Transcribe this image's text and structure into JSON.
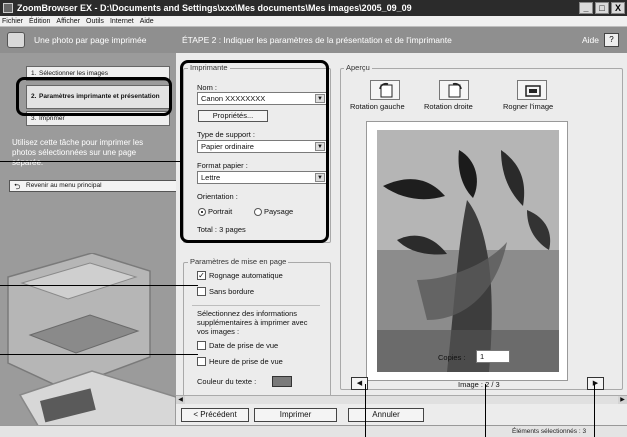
{
  "window": {
    "title": "ZoomBrowser EX - D:\\Documents and Settings\\xxx\\Mes documents\\Mes images\\2005_09_09",
    "controls": [
      "_",
      "□",
      "X"
    ]
  },
  "menu": [
    "Fichier",
    "Édition",
    "Afficher",
    "Outils",
    "Internet",
    "Aide"
  ],
  "taskbar": {
    "task_title": "Une photo par page imprimée",
    "step_title": "ÉTAPE 2 : Indiquer les paramètres de la présentation et de l'imprimante",
    "help_label": "Aide",
    "help_button": "?"
  },
  "sidebar": {
    "steps": [
      {
        "num": "1.",
        "label": "Sélectionner les images"
      },
      {
        "num": "2.",
        "label": "Paramètres imprimante et présentation"
      },
      {
        "num": "3.",
        "label": "Imprimer"
      }
    ],
    "hint": "Utilisez cette tâche pour imprimer les photos sélectionnées sur une page séparée.",
    "back_button": "Revenir au menu principal"
  },
  "printer_group": {
    "title": "Imprimante",
    "name_label": "Nom :",
    "name_value": "Canon XXXXXXXX",
    "properties_button": "Propriétés...",
    "media_label": "Type de support :",
    "media_value": "Papier ordinaire",
    "paper_label": "Format papier :",
    "paper_value": "Lettre",
    "orientation_label": "Orientation :",
    "portrait": "Portrait",
    "landscape": "Paysage",
    "total": "Total : 3 pages"
  },
  "layout_group": {
    "title": "Paramètres de mise en page",
    "auto_crop": "Rognage automatique",
    "borderless": "Sans bordure",
    "info_text": "Sélectionnez des informations supplémentaires à imprimer avec vos images :",
    "shooting_date": "Date de prise de vue",
    "shooting_time": "Heure de prise de vue",
    "text_color_label": "Couleur du texte :",
    "text_color": "#7a7a7a"
  },
  "preview": {
    "title": "Aperçu",
    "rotate_left": "Rotation gauche",
    "rotate_right": "Rotation droite",
    "crop": "Rogner l'image",
    "copies_label": "Copies :",
    "copies_value": "1",
    "image_label": "Image : 2 / 3"
  },
  "footer": {
    "previous": "< Précédent",
    "print": "Imprimer",
    "cancel": "Annuler"
  },
  "status": {
    "text": "Éléments sélectionnés : 3"
  }
}
